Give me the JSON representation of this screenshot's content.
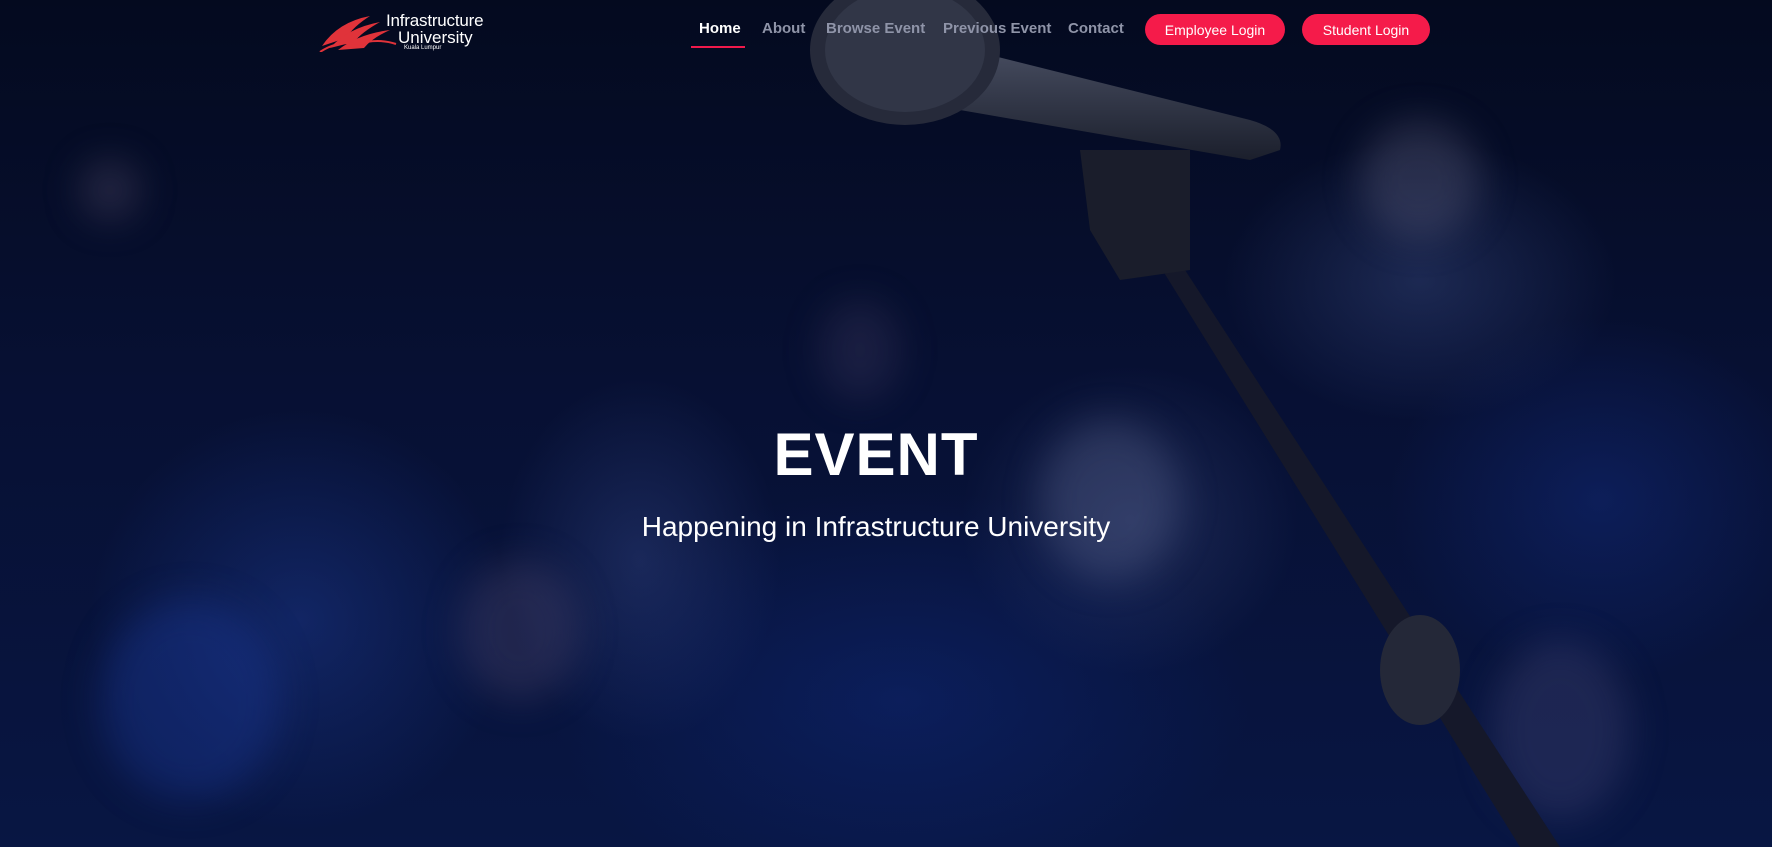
{
  "brand": {
    "line1": "Infrastructure",
    "line2": "University",
    "line3": "Kuala Lumpur",
    "logo_color": "#e0333a"
  },
  "nav": {
    "items": [
      {
        "label": "Home",
        "active": true
      },
      {
        "label": "About",
        "active": false
      },
      {
        "label": "Browse Event",
        "active": false
      },
      {
        "label": "Previous Event",
        "active": false
      },
      {
        "label": "Contact",
        "active": false
      }
    ],
    "employee_login": "Employee Login",
    "student_login": "Student Login"
  },
  "hero": {
    "title": "EVENT",
    "subtitle": "Happening in Infrastructure University"
  },
  "colors": {
    "accent": "#f51b4a",
    "background": "#060c24",
    "nav_inactive": "#8f94a8"
  },
  "icons": {
    "logo": "book-wings-logo-icon",
    "background": "microphone-stage-photo"
  }
}
